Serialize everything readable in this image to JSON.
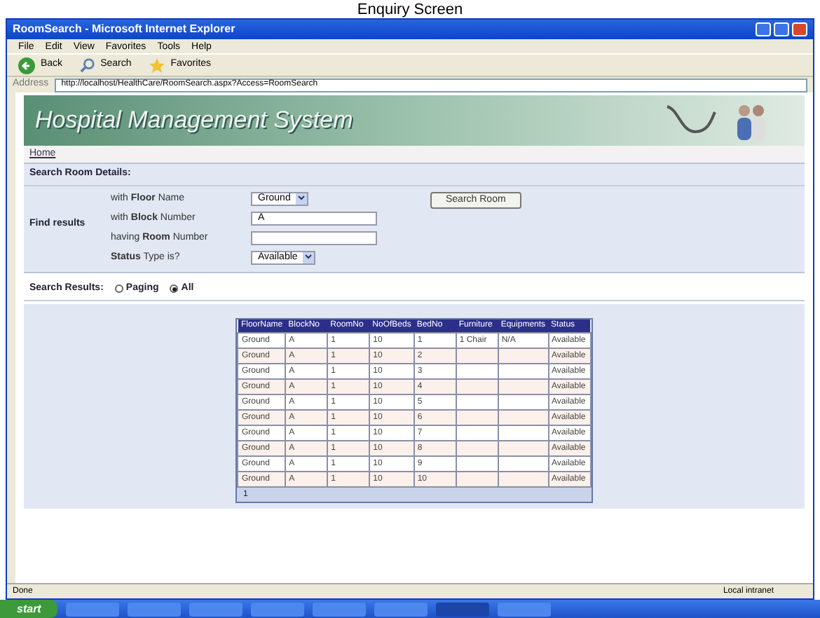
{
  "caption": "Enquiry Screen",
  "window": {
    "title": "RoomSearch - Microsoft Internet Explorer"
  },
  "menu": [
    "File",
    "Edit",
    "View",
    "Favorites",
    "Tools",
    "Help"
  ],
  "toolbar": [
    {
      "kind": "back",
      "label": "Back"
    },
    {
      "kind": "search",
      "label": "Search"
    },
    {
      "kind": "favorites",
      "label": "Favorites"
    }
  ],
  "address": {
    "label": "Address",
    "value": "http://localhost/HealthCare/RoomSearch.aspx?Access=RoomSearch"
  },
  "page": {
    "banner_title": "Hospital Management System",
    "nav": [
      "Home"
    ],
    "search_title": "Search Room Details:",
    "find_label": "Find results",
    "fields": [
      {
        "kind": "select",
        "label": "with **Floor** Name",
        "value": "Ground"
      },
      {
        "kind": "text",
        "label": "with **Block** Number",
        "value": "A"
      },
      {
        "kind": "text",
        "label": "having **Room** Number"
      },
      {
        "kind": "select",
        "label": "**Status** Type is?",
        "value": "Available"
      }
    ],
    "search_button": "Search Room",
    "results_label": "Search Results:",
    "modes": [
      {
        "label": "Paging",
        "selected": false
      },
      {
        "label": "All",
        "selected": true
      }
    ],
    "table": {
      "columns": [
        "FloorName",
        "BlockNo",
        "RoomNo",
        "NoOfBeds",
        "BedNo",
        "Furniture",
        "Equipments",
        "Status"
      ],
      "rows": [
        [
          "Ground",
          "A",
          "1",
          "10",
          "1",
          "1 Chair",
          "N/A",
          "Available"
        ],
        [
          "Ground",
          "A",
          "1",
          "10",
          "2",
          "",
          "",
          "Available"
        ],
        [
          "Ground",
          "A",
          "1",
          "10",
          "3",
          "",
          "",
          "Available"
        ],
        [
          "Ground",
          "A",
          "1",
          "10",
          "4",
          "",
          "",
          "Available"
        ],
        [
          "Ground",
          "A",
          "1",
          "10",
          "5",
          "",
          "",
          "Available"
        ],
        [
          "Ground",
          "A",
          "1",
          "10",
          "6",
          "",
          "",
          "Available"
        ],
        [
          "Ground",
          "A",
          "1",
          "10",
          "7",
          "",
          "",
          "Available"
        ],
        [
          "Ground",
          "A",
          "1",
          "10",
          "8",
          "",
          "",
          "Available"
        ],
        [
          "Ground",
          "A",
          "1",
          "10",
          "9",
          "",
          "",
          "Available"
        ],
        [
          "Ground",
          "A",
          "1",
          "10",
          "10",
          "",
          "",
          "Available"
        ]
      ],
      "pager": [
        "1"
      ]
    }
  },
  "status_bar": {
    "text": "Done",
    "zone": "Local intranet"
  },
  "taskbar": {
    "start": "start"
  }
}
